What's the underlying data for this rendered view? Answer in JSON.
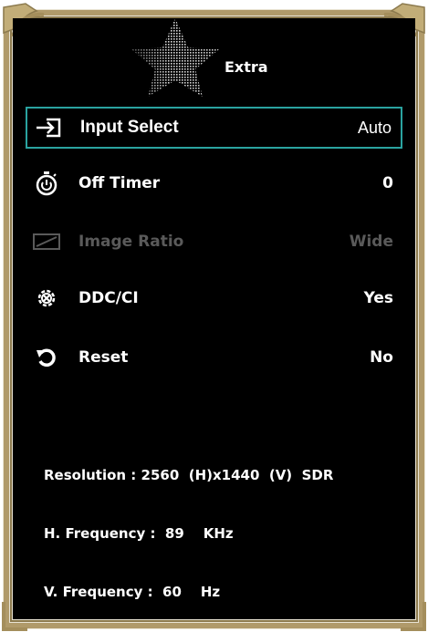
{
  "menu": {
    "title": "Extra",
    "items": [
      {
        "icon": "input-select-icon",
        "label": "Input Select",
        "value": "Auto",
        "state": "selected"
      },
      {
        "icon": "timer-icon",
        "label": "Off Timer",
        "value": "0",
        "state": "normal"
      },
      {
        "icon": "image-ratio-icon",
        "label": "Image Ratio",
        "value": "Wide",
        "state": "disabled"
      },
      {
        "icon": "ddc-ci-icon",
        "label": "DDC/CI",
        "value": "Yes",
        "state": "normal"
      },
      {
        "icon": "reset-icon",
        "label": "Reset",
        "value": "No",
        "state": "normal"
      }
    ]
  },
  "info": {
    "resolution": "Resolution : 2560  (H)x1440  (V)  SDR",
    "h_frequency": "H. Frequency :  89    KHz",
    "v_frequency": "V. Frequency :  60    Hz"
  },
  "colors": {
    "frame": "#b09a6a",
    "panel": "#000000",
    "highlight": "#2aa3a0",
    "text": "#ffffff",
    "disabled_text": "#5a5a5a"
  }
}
